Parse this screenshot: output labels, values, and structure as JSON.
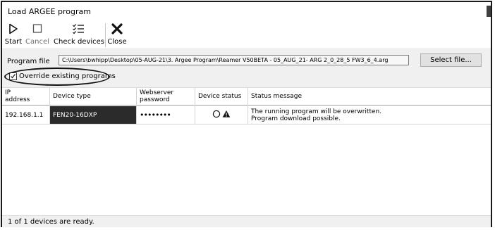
{
  "window": {
    "title": "Load ARGEE program"
  },
  "toolbar": {
    "start": {
      "label": "Start",
      "icon": "play-icon"
    },
    "cancel": {
      "label": "Cancel",
      "icon": "stop-icon"
    },
    "check_devices": {
      "label": "Check devices",
      "icon": "checklist-icon"
    },
    "close": {
      "label": "Close",
      "icon": "close-icon"
    }
  },
  "program": {
    "label": "Program file",
    "path": "C:\\Users\\bwhipp\\Desktop\\05-AUG-21\\3. Argee Program\\Reamer V50BETA - 05_AUG_21- ARG 2_0_28_5 FW3_6_4.arg",
    "select_button": "Select file...",
    "override_label": "Override existing programs",
    "override_checked": true
  },
  "table": {
    "headers": {
      "ip": "IP\naddress",
      "device_type": "Device type",
      "password": "Webserver\npassword",
      "device_status": "Device status",
      "status_message": "Status message"
    },
    "rows": [
      {
        "ip": "192.168.1.1",
        "device_type": "FEN20-16DXP",
        "password": "••••••••",
        "status_icons": [
          "circle-outline-icon",
          "warning-triangle-icon"
        ],
        "message_line1": "The running program will be overwritten.",
        "message_line2": "Program download possible."
      }
    ]
  },
  "status_bar": {
    "text": "1 of 1 devices are ready."
  },
  "colors": {
    "selected_cell_bg": "#2b2b2b",
    "toolbar_bg": "#ffffff",
    "panel_bg": "#f0f0f0"
  }
}
